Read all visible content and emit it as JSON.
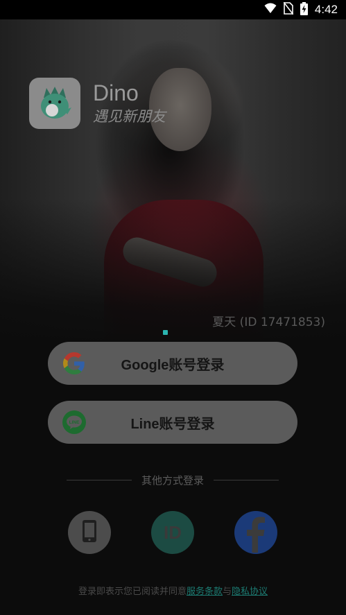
{
  "status_bar": {
    "time": "4:42",
    "icons": [
      "wifi-icon",
      "no-sim-icon",
      "battery-charging-icon"
    ]
  },
  "brand": {
    "name": "Dino",
    "slogan": "遇见新朋友",
    "icon": "dino-mascot-icon"
  },
  "hero": {
    "owner_label": "夏天 (ID 17471853)"
  },
  "login": {
    "google_label": "Google账号登录",
    "line_label": "Line账号登录",
    "line_icon_text": "LINE"
  },
  "other_methods": {
    "divider_text": "其他方式登录",
    "id_text": "ID",
    "buttons": [
      "phone-icon",
      "id-icon",
      "facebook-icon"
    ]
  },
  "terms": {
    "prefix": "登录即表示您已阅读并同意",
    "service_link": "服务条款",
    "conjunction": "与",
    "privacy_link": "隐私协议"
  },
  "colors": {
    "background": "#0c0c0c",
    "button": "#5b5b5b",
    "accent": "#1c7c73",
    "facebook": "#1b3a78"
  }
}
